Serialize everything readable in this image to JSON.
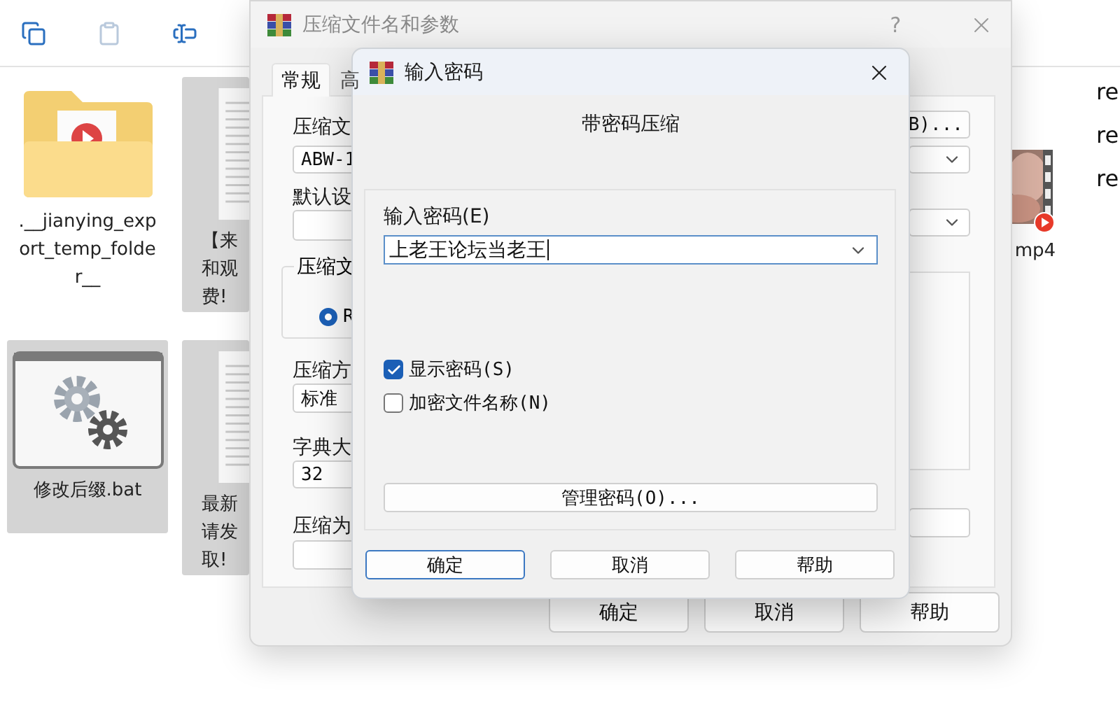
{
  "explorer": {
    "toolbar": [
      {
        "kind": "copy",
        "disabled": false
      },
      {
        "kind": "paste",
        "disabled": true
      },
      {
        "kind": "rename",
        "disabled": false
      }
    ],
    "files": [
      {
        "kind": "folder",
        "lines": [
          ".__jianying_exp",
          "ort_temp_folde",
          "r__"
        ],
        "selected": false
      },
      {
        "kind": "document",
        "lines": [
          "【来",
          "和观",
          "费!"
        ],
        "selected": true
      },
      {
        "kind": "video",
        "lines": [
          "mp4"
        ],
        "selected": false
      },
      {
        "kind": "batch",
        "lines": [
          "修改后缀.bat"
        ],
        "selected": true
      },
      {
        "kind": "document",
        "lines": [
          "最新",
          "请发",
          "取!"
        ],
        "selected": true
      }
    ],
    "details": [
      "re",
      "re",
      "re"
    ]
  },
  "archive_window": {
    "title": "压缩文件名和参数",
    "help": "?",
    "tabs": [
      {
        "label": "常规",
        "selected": true
      },
      {
        "label": "高",
        "selected": false
      }
    ],
    "archive_name": {
      "label": "压缩文",
      "value": "ABW-1",
      "browse_button": "B)..."
    },
    "profile": {
      "label": "默认设"
    },
    "format_group": {
      "label": "压缩文",
      "options": [
        {
          "label": "R",
          "selected": true
        }
      ]
    },
    "method": {
      "label": "压缩方",
      "value": "标准"
    },
    "dictionary": {
      "label": "字典大",
      "value": "32"
    },
    "split": {
      "label": "压缩为"
    },
    "buttons": [
      "确定",
      "取消",
      "帮助"
    ]
  },
  "password_dialog": {
    "title": "输入密码",
    "heading": "带密码压缩",
    "password": {
      "label": "输入密码(E)",
      "value": "上老王论坛当老王"
    },
    "options": [
      {
        "label": "显示密码(S)",
        "checked": true
      },
      {
        "label": "加密文件名称(N)",
        "checked": false
      }
    ],
    "manage_button": "管理密码(O)...",
    "buttons": [
      {
        "label": "确定",
        "focused": true
      },
      {
        "label": "取消",
        "focused": false
      },
      {
        "label": "帮助",
        "focused": false
      }
    ]
  }
}
